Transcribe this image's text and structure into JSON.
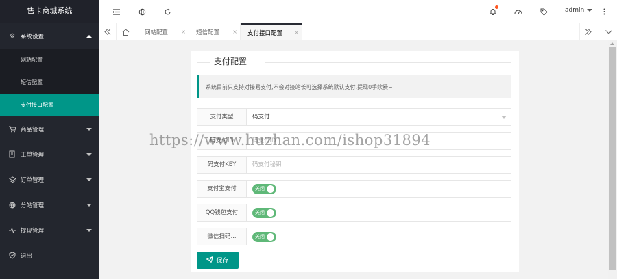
{
  "app": {
    "title": "售卡商城系统"
  },
  "sidebar": {
    "items": [
      {
        "label": "系统设置",
        "icon": "gear-icon",
        "open": true,
        "children": [
          {
            "label": "网站配置",
            "active": false
          },
          {
            "label": "短信配置",
            "active": false
          },
          {
            "label": "支付接口配置",
            "active": true
          }
        ]
      },
      {
        "label": "商品管理",
        "icon": "cart-icon"
      },
      {
        "label": "工单管理",
        "icon": "ticket-icon"
      },
      {
        "label": "订单管理",
        "icon": "layers-icon"
      },
      {
        "label": "分站管理",
        "icon": "globe-icon"
      },
      {
        "label": "提现管理",
        "icon": "pulse-icon"
      },
      {
        "label": "退出",
        "icon": "shield-icon"
      }
    ]
  },
  "header": {
    "user": "admin",
    "icons": [
      "menu-fold-icon",
      "globe-icon",
      "refresh-icon",
      "notification-icon",
      "theme-icon",
      "tag-icon",
      "more-icon"
    ]
  },
  "tabs": {
    "items": [
      {
        "label": "网站配置",
        "active": false
      },
      {
        "label": "短信配置",
        "active": false
      },
      {
        "label": "支付接口配置",
        "active": true
      }
    ],
    "close": "×"
  },
  "card": {
    "title": "支付配置",
    "notice": "系统目前只支持对接易支付,不会对接站长可选择系统默认支付,提现0手续费~",
    "fields": [
      {
        "label": "支付类型",
        "value": "码支付",
        "type": "select"
      },
      {
        "label": "码支付ID",
        "placeholder": "码支付ID",
        "type": "input"
      },
      {
        "label": "码支付KEY",
        "placeholder": "码支付秘钥",
        "type": "input"
      },
      {
        "label": "支付宝支付",
        "value": "关闭",
        "type": "switch"
      },
      {
        "label": "QQ钱包支付",
        "value": "关闭",
        "type": "switch"
      },
      {
        "label": "微信扫码...",
        "value": "关闭",
        "type": "switch"
      }
    ],
    "save_label": "保存"
  },
  "watermark": "https://www.huzhan.com/ishop31894",
  "colors": {
    "accent": "#009688",
    "sidebar_bg": "#23262e",
    "switch_bg": "#5fb878",
    "badge": "#ff5722"
  }
}
